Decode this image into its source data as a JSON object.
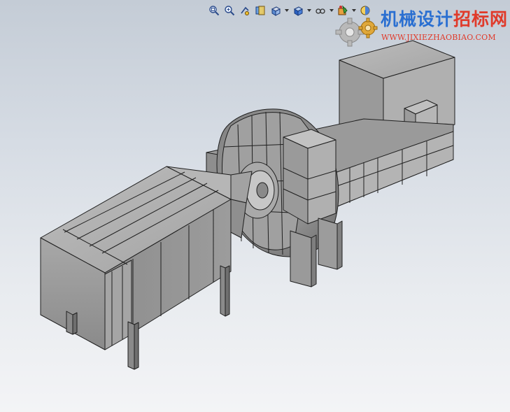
{
  "window": {
    "app": "SolidWorks",
    "view": "Isometric model view"
  },
  "toolbar": {
    "buttons": [
      {
        "icon": "zoom-to-fit-icon",
        "has_dropdown": false
      },
      {
        "icon": "zoom-to-area-icon",
        "has_dropdown": false
      },
      {
        "icon": "previous-view-icon",
        "has_dropdown": false
      },
      {
        "icon": "section-view-icon",
        "has_dropdown": false
      },
      {
        "icon": "view-orientation-icon",
        "has_dropdown": true
      },
      {
        "icon": "display-style-icon",
        "has_dropdown": true
      },
      {
        "icon": "hide-show-items-icon",
        "has_dropdown": true
      },
      {
        "icon": "edit-appearance-icon",
        "has_dropdown": true
      },
      {
        "icon": "apply-scene-icon",
        "has_dropdown": true
      }
    ]
  },
  "watermark": {
    "title_part1": "机械设计",
    "title_part2": "招标网",
    "url": "WWW.JIXIEZHAOBIAO.COM",
    "colors": {
      "title_part1": "#2a6fd1",
      "title_part2": "#e03a2a",
      "url": "#e03a2a"
    }
  },
  "model": {
    "description_colors": {
      "steel": "#9a9a9a",
      "steel_dark": "#6e6e6e",
      "steel_light": "#bdbdbd",
      "edge": "#1f1f1f"
    }
  }
}
